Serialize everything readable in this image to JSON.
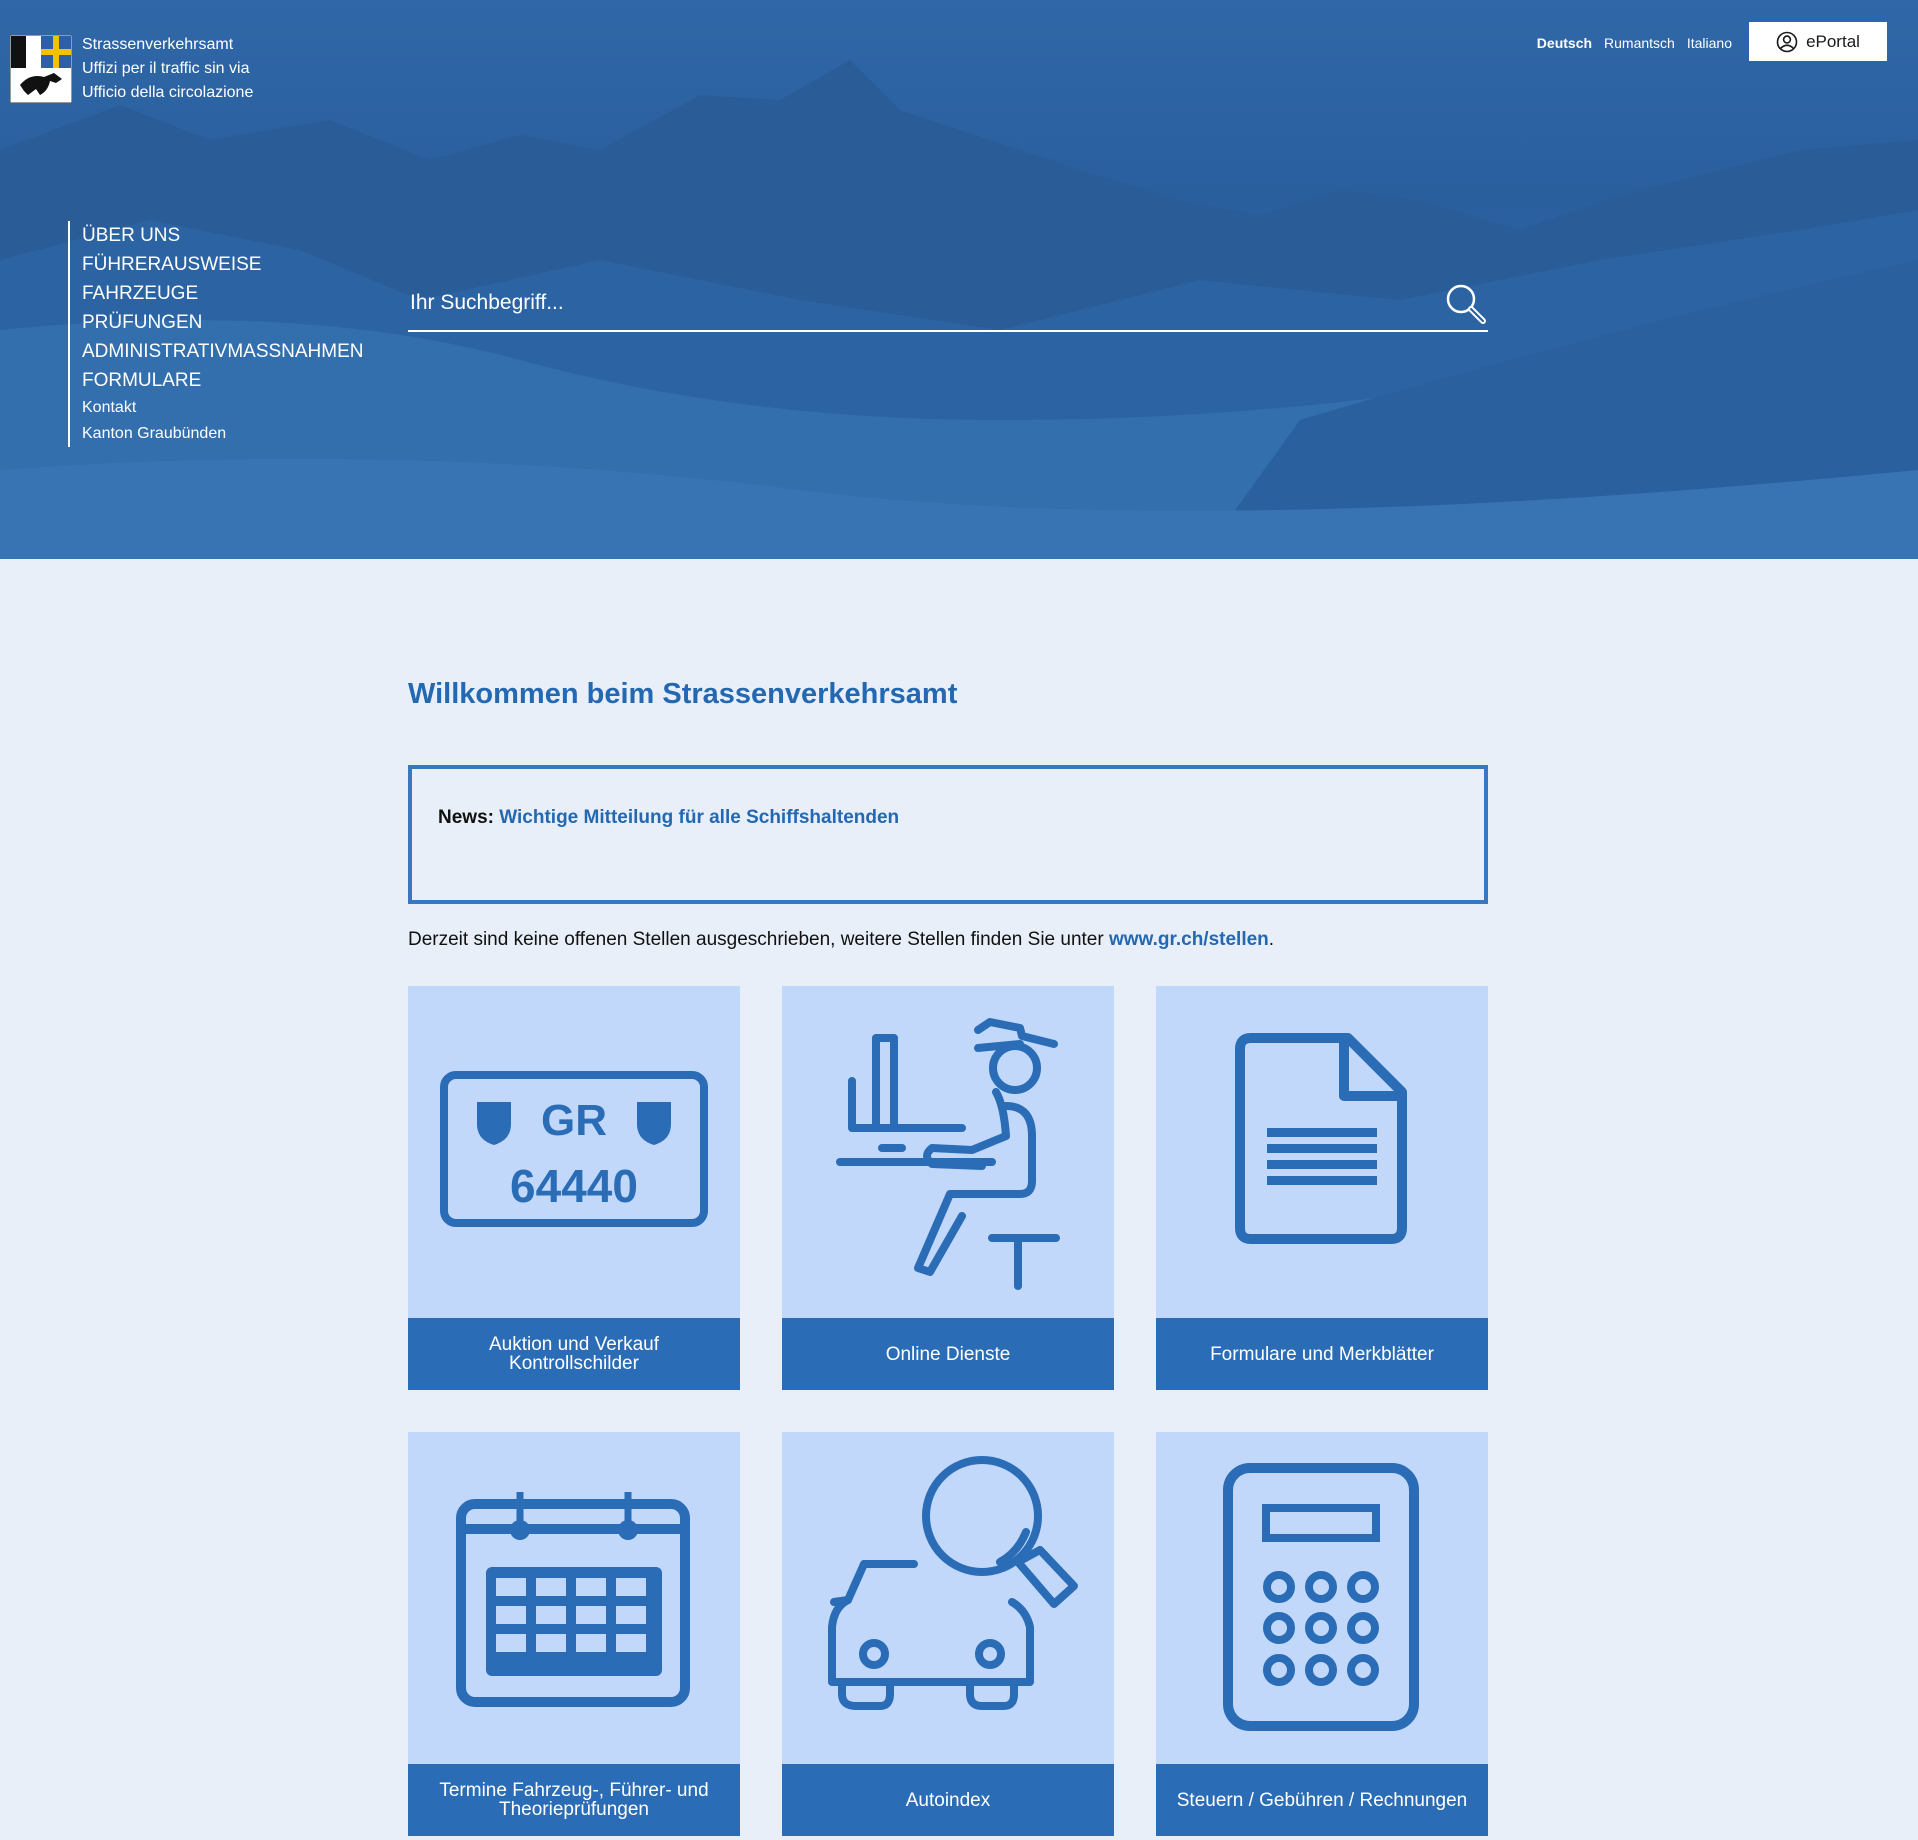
{
  "header": {
    "org_lines": [
      "Strassenverkehrsamt",
      "Uffizi per il traffic sin via",
      "Ufficio della circolazione"
    ],
    "languages": [
      "Deutsch",
      "Rumantsch",
      "Italiano"
    ],
    "active_language": "Deutsch",
    "eportal_label": "ePortal"
  },
  "nav": {
    "main_items": [
      "ÜBER UNS",
      "FÜHRERAUSWEISE",
      "FAHRZEUGE",
      "PRÜFUNGEN",
      "ADMINISTRATIVMASSNAHMEN",
      "FORMULARE"
    ],
    "secondary_items": [
      "Kontakt",
      "Kanton Graubünden"
    ]
  },
  "search": {
    "placeholder": "Ihr Suchbegriff..."
  },
  "main": {
    "title": "Willkommen beim Strassenverkehrsamt",
    "news_label": "News:",
    "news_link": "Wichtige Mitteilung für alle Schiffshaltenden",
    "jobs_text": "Derzeit sind keine offenen Stellen ausgeschrieben, weitere Stellen finden Sie unter ",
    "jobs_link": "www.gr.ch/stellen",
    "jobs_end": "."
  },
  "plate": {
    "canton": "GR",
    "number": "64440"
  },
  "tiles": [
    {
      "label": "Auktion und Verkauf Kontrollschilder",
      "icon": "license-plate-icon"
    },
    {
      "label": "Online Dienste",
      "icon": "person-at-computer-icon"
    },
    {
      "label": "Formulare und Merkblätter",
      "icon": "document-icon"
    },
    {
      "label": "Termine Fahrzeug-, Führer- und Theorieprüfungen",
      "icon": "calendar-icon"
    },
    {
      "label": "Autoindex",
      "icon": "car-search-icon"
    },
    {
      "label": "Steuern / Gebühren / Rechnungen",
      "icon": "calculator-icon"
    }
  ],
  "colors": {
    "brand_blue": "#2a6cb5",
    "tile_bg": "#c1d8fb",
    "page_bg": "#e8eff8",
    "link": "#2368b1"
  }
}
